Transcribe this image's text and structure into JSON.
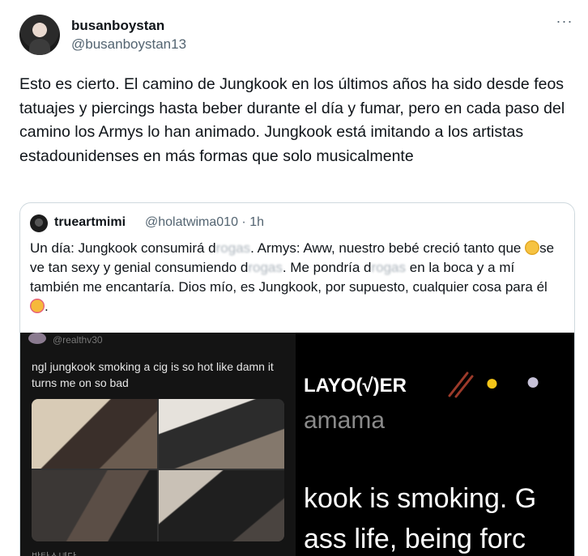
{
  "author": {
    "display_name": "busanboystan",
    "handle": "@busanboystan13",
    "avatar_icon": "profile-photo",
    "more_label": "···"
  },
  "tweet": {
    "text": "Esto es cierto. El camino de Jungkook en los últimos años ha sido desde feos tatuajes y piercings hasta beber durante el día y fumar, pero en cada paso del camino los Armys lo han animado. Jungkook está imitando a los artistas estadounidenses en más formas que solo musicalmente"
  },
  "quote": {
    "display_name": "trueartmimi",
    "handle": "@holatwima010",
    "separator": "·",
    "time": "1h",
    "text_parts": {
      "p1": "Un día: Jungkook consumirá d",
      "b1": "rogas",
      "p2": ". Armys: Aww, nuestro bebé creció tanto que ",
      "p3": "se ve tan sexy y genial consumiendo d",
      "b2": "rogas",
      "p4": ". Me pondría d",
      "b3": "rogas",
      "p5": " en la boca y a mí también me encantaría. Dios mío, es Jungkook, por supuesto, cualquier cosa para él ",
      "p6": "."
    },
    "emoji_1": "pleading-face-emoji",
    "emoji_2": "smiling-face-with-hearts-emoji"
  },
  "media_left": {
    "handle": "@realthv30",
    "caption": "ngl jungkook smoking a cig is so hot like damn it turns me on so bad",
    "footer": "방탄소년단"
  },
  "media_right": {
    "title": "LAYO(√)ER",
    "icons": [
      "chopsticks-icon",
      "chick-icon",
      "bunny-icon"
    ],
    "subtitle": "amama",
    "line1": "kook is smoking. G",
    "line2": "ass life, being forc"
  }
}
